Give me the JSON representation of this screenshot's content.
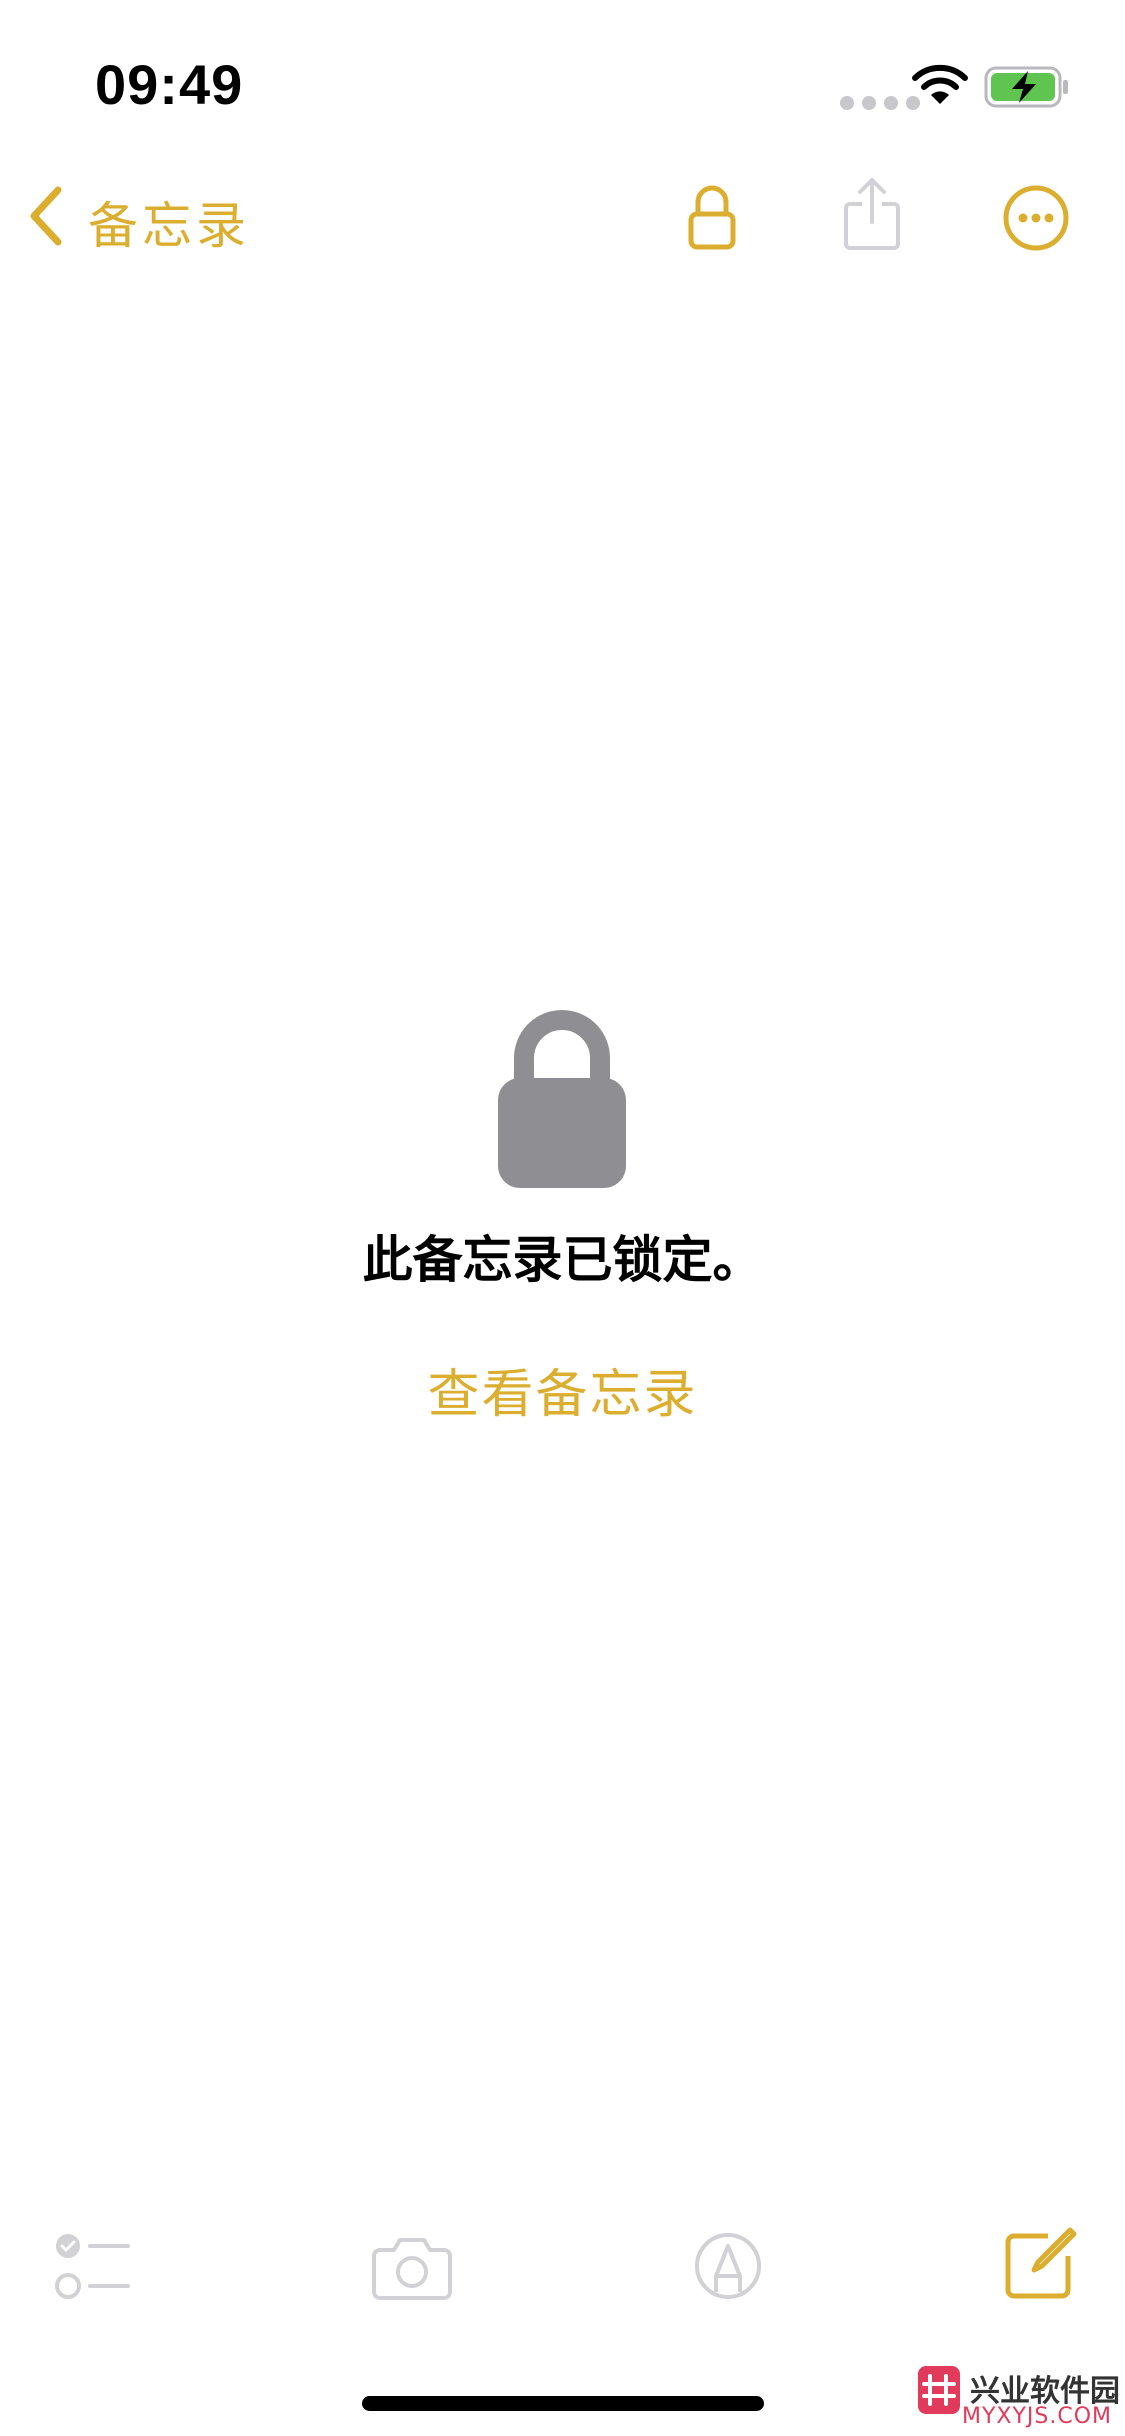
{
  "status_bar": {
    "time": "09:49"
  },
  "nav": {
    "back_label": "备忘录"
  },
  "locked_note": {
    "message": "此备忘录已锁定。",
    "view_button": "查看备忘录"
  },
  "toolbar": {
    "icons": [
      "checklist-icon",
      "camera-icon",
      "markup-icon",
      "compose-icon"
    ]
  },
  "watermark": {
    "title": "兴业软件园",
    "subtitle": "MYXYJS.COM"
  },
  "colors": {
    "accent": "#dcae2f",
    "disabled": "#d1d1d6",
    "lock_gray": "#8e8e93",
    "background": "#ffffff"
  }
}
